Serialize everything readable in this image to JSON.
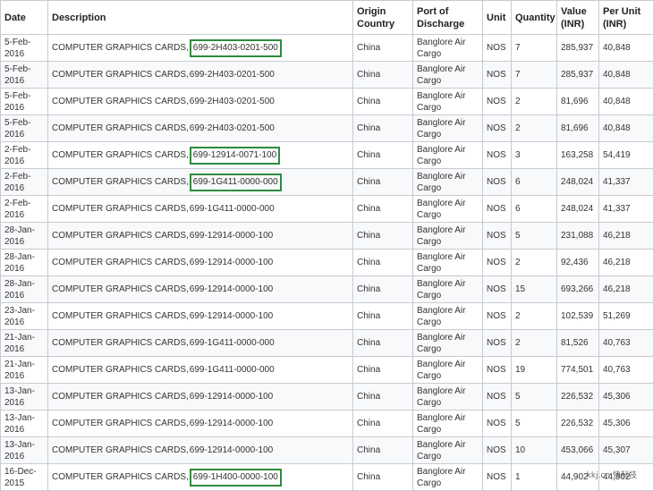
{
  "columns": [
    "Date",
    "Description",
    "Origin Country",
    "Port of Discharge",
    "Unit",
    "Quantity",
    "Value (INR)",
    "Per Unit (INR)"
  ],
  "rows": [
    {
      "date": "5-Feb-2016",
      "desc": "COMPUTER GRAPHICS CARDS,",
      "part": "699-2H403-0201-500",
      "hl": true,
      "country": "China",
      "port": "Banglore Air Cargo",
      "unit": "NOS",
      "qty": "7",
      "value": "285,937",
      "per": "40,848"
    },
    {
      "date": "5-Feb-2016",
      "desc": "COMPUTER GRAPHICS CARDS,",
      "part": "699-2H403-0201-500",
      "hl": false,
      "country": "China",
      "port": "Banglore Air Cargo",
      "unit": "NOS",
      "qty": "7",
      "value": "285,937",
      "per": "40,848"
    },
    {
      "date": "5-Feb-2016",
      "desc": "COMPUTER GRAPHICS CARDS,",
      "part": "699-2H403-0201-500",
      "hl": false,
      "country": "China",
      "port": "Banglore Air Cargo",
      "unit": "NOS",
      "qty": "2",
      "value": "81,696",
      "per": "40,848"
    },
    {
      "date": "5-Feb-2016",
      "desc": "COMPUTER GRAPHICS CARDS,",
      "part": "699-2H403-0201-500",
      "hl": false,
      "country": "China",
      "port": "Banglore Air Cargo",
      "unit": "NOS",
      "qty": "2",
      "value": "81,696",
      "per": "40,848"
    },
    {
      "date": "2-Feb-2016",
      "desc": "COMPUTER GRAPHICS CARDS,",
      "part": "699-12914-0071-100",
      "hl": true,
      "country": "China",
      "port": "Banglore Air Cargo",
      "unit": "NOS",
      "qty": "3",
      "value": "163,258",
      "per": "54,419"
    },
    {
      "date": "2-Feb-2016",
      "desc": "COMPUTER GRAPHICS CARDS,",
      "part": "699-1G411-0000-000",
      "hl": true,
      "country": "China",
      "port": "Banglore Air Cargo",
      "unit": "NOS",
      "qty": "6",
      "value": "248,024",
      "per": "41,337"
    },
    {
      "date": "2-Feb-2016",
      "desc": "COMPUTER GRAPHICS CARDS,",
      "part": "699-1G411-0000-000",
      "hl": false,
      "country": "China",
      "port": "Banglore Air Cargo",
      "unit": "NOS",
      "qty": "6",
      "value": "248,024",
      "per": "41,337"
    },
    {
      "date": "28-Jan-2016",
      "desc": "COMPUTER GRAPHICS CARDS,",
      "part": "699-12914-0000-100",
      "hl": false,
      "country": "China",
      "port": "Banglore Air Cargo",
      "unit": "NOS",
      "qty": "5",
      "value": "231,088",
      "per": "46,218"
    },
    {
      "date": "28-Jan-2016",
      "desc": "COMPUTER GRAPHICS CARDS,",
      "part": "699-12914-0000-100",
      "hl": false,
      "country": "China",
      "port": "Banglore Air Cargo",
      "unit": "NOS",
      "qty": "2",
      "value": "92,436",
      "per": "46,218"
    },
    {
      "date": "28-Jan-2016",
      "desc": "COMPUTER GRAPHICS CARDS,",
      "part": "699-12914-0000-100",
      "hl": false,
      "country": "China",
      "port": "Banglore Air Cargo",
      "unit": "NOS",
      "qty": "15",
      "value": "693,266",
      "per": "46,218"
    },
    {
      "date": "23-Jan-2016",
      "desc": "COMPUTER GRAPHICS CARDS,",
      "part": "699-12914-0000-100",
      "hl": false,
      "country": "China",
      "port": "Banglore Air Cargo",
      "unit": "NOS",
      "qty": "2",
      "value": "102,539",
      "per": "51,269"
    },
    {
      "date": "21-Jan-2016",
      "desc": "COMPUTER GRAPHICS CARDS,",
      "part": "699-1G411-0000-000",
      "hl": false,
      "country": "China",
      "port": "Banglore Air Cargo",
      "unit": "NOS",
      "qty": "2",
      "value": "81,526",
      "per": "40,763"
    },
    {
      "date": "21-Jan-2016",
      "desc": "COMPUTER GRAPHICS CARDS,",
      "part": "699-1G411-0000-000",
      "hl": false,
      "country": "China",
      "port": "Banglore Air Cargo",
      "unit": "NOS",
      "qty": "19",
      "value": "774,501",
      "per": "40,763"
    },
    {
      "date": "13-Jan-2016",
      "desc": "COMPUTER GRAPHICS CARDS,",
      "part": "699-12914-0000-100",
      "hl": false,
      "country": "China",
      "port": "Banglore Air Cargo",
      "unit": "NOS",
      "qty": "5",
      "value": "226,532",
      "per": "45,306"
    },
    {
      "date": "13-Jan-2016",
      "desc": "COMPUTER GRAPHICS CARDS,",
      "part": "699-12914-0000-100",
      "hl": false,
      "country": "China",
      "port": "Banglore Air Cargo",
      "unit": "NOS",
      "qty": "5",
      "value": "226,532",
      "per": "45,306"
    },
    {
      "date": "13-Jan-2016",
      "desc": "COMPUTER GRAPHICS CARDS,",
      "part": "699-12914-0000-100",
      "hl": false,
      "country": "China",
      "port": "Banglore Air Cargo",
      "unit": "NOS",
      "qty": "10",
      "value": "453,066",
      "per": "45,307"
    },
    {
      "date": "16-Dec-2015",
      "desc": "COMPUTER GRAPHICS CARDS,",
      "part": "699-1H400-0000-100",
      "hl": true,
      "country": "China",
      "port": "Banglore Air Cargo",
      "unit": "NOS",
      "qty": "1",
      "value": "44,902",
      "per": "44,902"
    }
  ],
  "watermark": "kkj.cn 快科技"
}
